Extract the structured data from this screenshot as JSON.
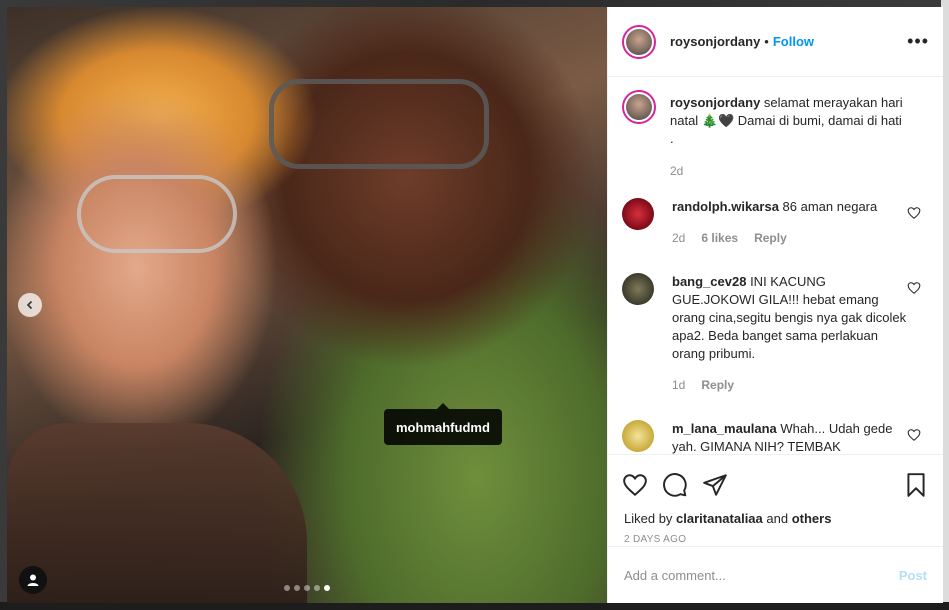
{
  "post": {
    "username": "roysonjordany",
    "separator": "•",
    "follow_label": "Follow",
    "more_label": "•••"
  },
  "caption": {
    "username": "roysonjordany",
    "text": "selamat merayakan hari natal 🎄🖤 Damai di bumi, damai di hati .",
    "time": "2d"
  },
  "comments": [
    {
      "username": "randolph.wikarsa",
      "text": "86 aman negara",
      "time": "2d",
      "likes": "6 likes",
      "reply_label": "Reply",
      "avatar_color": "#a8192c"
    },
    {
      "username": "bang_cev28",
      "text": "INI KACUNG GUE.JOKOWI GILA!!! hebat emang orang cina,segitu bengis nya gak dicolek apa2. Beda banget sama perlakuan orang pribumi.",
      "time": "1d",
      "reply_label": "Reply",
      "avatar_color": "#4a4a3a"
    },
    {
      "username": "m_lana_maulana",
      "text": "Whah... Udah gede yah. GIMANA NIH? TEMBAK",
      "avatar_color": "#e8d27a"
    }
  ],
  "photo": {
    "tag_username": "mohmahfudmd",
    "carousel_total": 5,
    "carousel_active": 5
  },
  "actions": {
    "liked_prefix": "Liked by",
    "liked_user": "claritanataliaa",
    "liked_and": "and",
    "liked_others": "others",
    "date": "2 DAYS AGO"
  },
  "add_comment": {
    "placeholder": "Add a comment...",
    "post_label": "Post"
  },
  "colors": {
    "link_blue": "#0095f6",
    "post_disabled": "#b2dffc",
    "story_ring": "#d6249f"
  },
  "icons": [
    "chevron-left-icon",
    "user-tag-icon",
    "more-icon",
    "heart-icon",
    "comment-icon",
    "share-icon",
    "bookmark-icon"
  ]
}
